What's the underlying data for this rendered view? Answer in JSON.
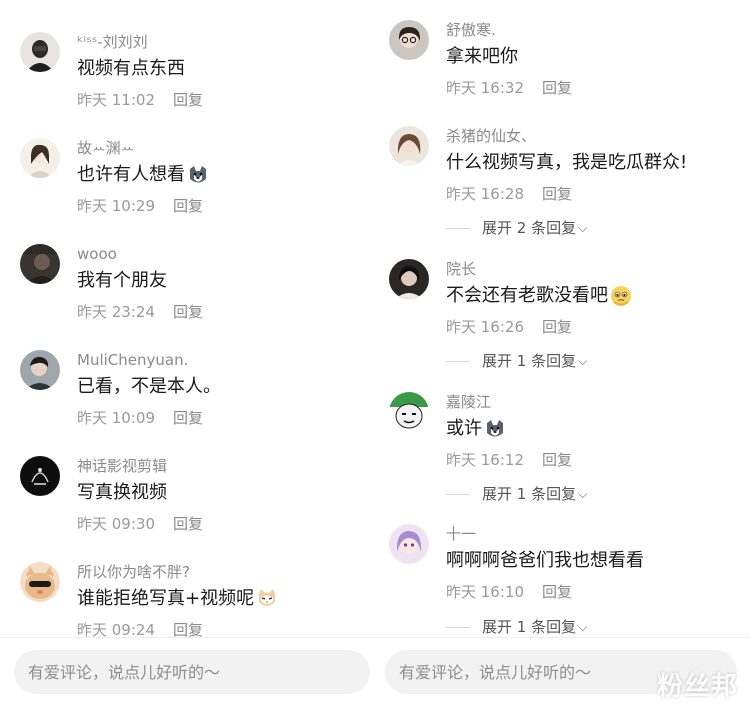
{
  "reply_label": "回复",
  "input_placeholder": "有爱评论，说点儿好听的～",
  "watermark": "粉丝邦",
  "left_comments": [
    {
      "username": "ᵏⁱˢˢ-刘刘刘",
      "content": "视频有点东西",
      "time": "昨天 11:02"
    },
    {
      "username": "故ꕀ渊ꕀ",
      "content": "也许有人想看",
      "time": "昨天 10:29",
      "emoji": "husky-emoji"
    },
    {
      "username": "wooo",
      "content": "我有个朋友",
      "time": "昨天 23:24"
    },
    {
      "username": "MuliChenyuan.",
      "content": "已看，不是本人。",
      "time": "昨天 10:09"
    },
    {
      "username": "神话影视剪辑",
      "content": "写真换视频",
      "time": "昨天 09:30"
    },
    {
      "username": "所以你为啥不胖?",
      "content": "谁能拒绝写真+视频呢",
      "time": "昨天 09:24",
      "emoji": "cat-emoji"
    }
  ],
  "right_comments": [
    {
      "username": "舒傲寒.",
      "content": "拿来吧你",
      "time": "昨天 16:32"
    },
    {
      "username": "杀猪的仙女、",
      "content": "什么视频写真，我是吃瓜群众!",
      "time": "昨天 16:28",
      "expand": "展开 2 条回复"
    },
    {
      "username": "院长",
      "content": "不会还有老歌没看吧",
      "time": "昨天 16:26",
      "emoji": "pleading-emoji",
      "expand": "展开 1 条回复"
    },
    {
      "username": "嘉陵江",
      "content": "或许",
      "time": "昨天 16:12",
      "emoji": "husky-emoji",
      "expand": "展开 1 条回复"
    },
    {
      "username": "十一",
      "content": "啊啊啊爸爸们我也想看看",
      "time": "昨天 16:10",
      "expand": "展开 1 条回复"
    }
  ],
  "colors": {
    "text_primary": "#1a1a1a",
    "text_secondary": "#8a8a8a",
    "input_bg": "#f2f2f2"
  }
}
